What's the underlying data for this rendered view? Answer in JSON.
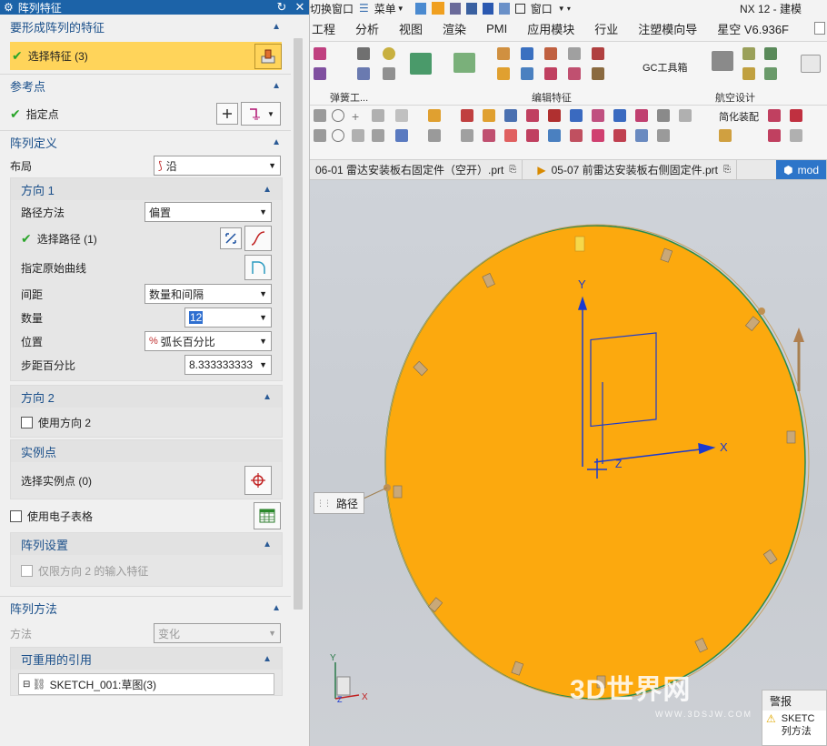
{
  "dialog": {
    "title": "阵列特征",
    "features_section": {
      "title": "要形成阵列的特征",
      "select_label": "选择特征 (3)"
    },
    "ref_section": {
      "title": "参考点",
      "point_label": "指定点"
    },
    "array_def": {
      "title": "阵列定义",
      "layout_label": "布局",
      "layout_value": "沿",
      "dir1": {
        "title": "方向 1",
        "path_method_label": "路径方法",
        "path_method_value": "偏置",
        "select_path_label": "选择路径 (1)",
        "orig_curve_label": "指定原始曲线",
        "spacing_label": "间距",
        "spacing_value": "数量和间隔",
        "count_label": "数量",
        "count_value": "12",
        "position_label": "位置",
        "position_value": "弧长百分比",
        "step_label": "步距百分比",
        "step_value": "8.333333333"
      },
      "dir2": {
        "title": "方向 2",
        "use_label": "使用方向 2"
      },
      "instance": {
        "title": "实例点",
        "select_label": "选择实例点 (0)"
      },
      "spreadsheet_label": "使用电子表格",
      "settings": {
        "title": "阵列设置",
        "only_dir2_label": "仅限方向 2 的输入特征"
      }
    },
    "method_section": {
      "title": "阵列方法",
      "method_label": "方法",
      "method_value": "变化",
      "reusable_title": "可重用的引用",
      "tree_item": "SKETCH_001:草图(3)"
    }
  },
  "toolbar": {
    "quick_access": [
      "切换窗口",
      "菜单",
      "窗口"
    ],
    "app_title": "NX 12 - 建模",
    "menu": [
      "工程",
      "分析",
      "视图",
      "渲染",
      "PMI",
      "应用模块",
      "行业",
      "注塑模向导",
      "星空 V6.936F"
    ],
    "groups": [
      "弹簧工...",
      "编辑特征",
      "GC工具箱",
      "航空设计"
    ],
    "simplify_label": "简化装配",
    "tabs": [
      "06-01 雷达安装板右固定件（空开）.prt",
      "05-07 前雷达安装板右侧固定件.prt",
      "mod"
    ]
  },
  "viewport": {
    "path_tag": "路径",
    "axes": {
      "x": "X",
      "y": "Y",
      "z": "Z"
    },
    "warning_title": "警报",
    "warning_text": [
      "SKETC",
      "列方法"
    ],
    "watermark": "3D世界网",
    "watermark_url": "WWW.3DSJW.COM",
    "disk_color": "#fca90e"
  }
}
